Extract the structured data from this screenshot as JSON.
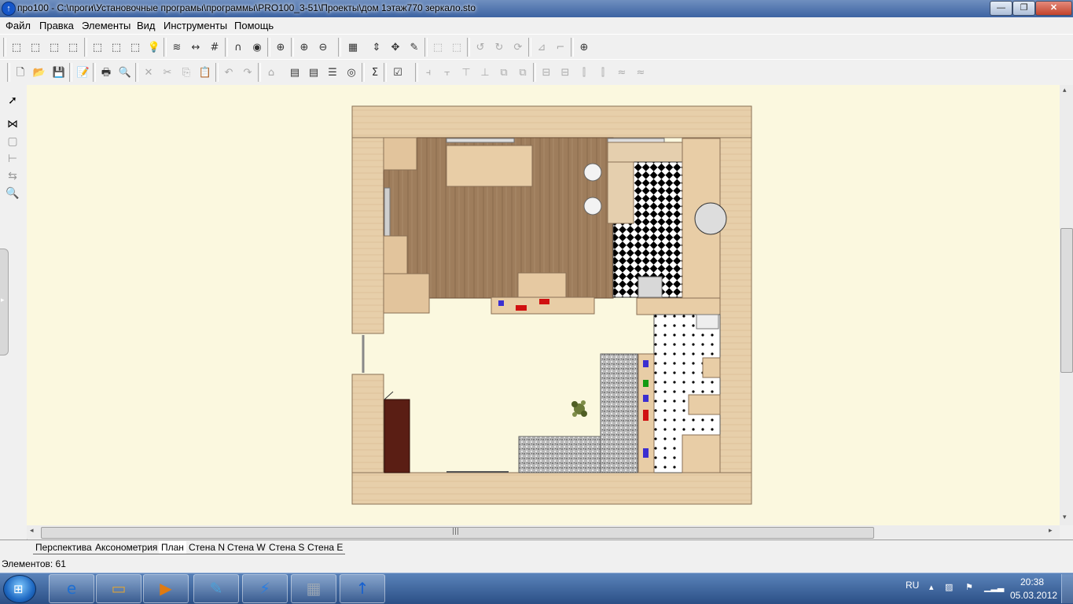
{
  "window": {
    "title": "про100 - С:\\проги\\Установочные програмы\\программы\\PRO100_3-51\\Проекты\\дом 1этаж770 зеркало.sto",
    "app_icon_glyph": "↑",
    "minimize_glyph": "—",
    "maximize_glyph": "❐",
    "close_glyph": "✕"
  },
  "menu": [
    "Файл",
    "Правка",
    "Элементы",
    "Вид",
    "Инструменты",
    "Помощь"
  ],
  "toolbar1": [
    {
      "name": "view-3d-icon-1",
      "glyph": "⬚"
    },
    {
      "name": "view-3d-icon-2",
      "glyph": "⬚"
    },
    {
      "name": "view-3d-icon-3",
      "glyph": "⬚"
    },
    {
      "name": "view-3d-icon-4",
      "glyph": "⬚"
    },
    {
      "name": "view-3d-icon-5",
      "glyph": "⬚"
    },
    {
      "name": "view-3d-icon-6",
      "glyph": "⬚"
    },
    {
      "name": "view-3d-icon-7",
      "glyph": "⬚"
    },
    {
      "name": "light-bulb-icon",
      "glyph": "💡"
    },
    {
      "name": "texture-icon",
      "glyph": "≋"
    },
    {
      "name": "dimension-icon",
      "glyph": "↔"
    },
    {
      "name": "grid-icon",
      "glyph": "#"
    },
    {
      "name": "magnet-icon",
      "glyph": "∩"
    },
    {
      "name": "render-icon",
      "glyph": "◉"
    },
    {
      "name": "target-icon",
      "glyph": "⊕"
    },
    {
      "name": "zoom-in-icon",
      "glyph": "⊕"
    },
    {
      "name": "zoom-out-icon",
      "glyph": "⊖"
    },
    {
      "name": "select-grid-icon",
      "glyph": "▦"
    },
    {
      "name": "lift-icon",
      "glyph": "⇕"
    },
    {
      "name": "move-icon",
      "glyph": "✥"
    },
    {
      "name": "edit-icon",
      "glyph": "✎"
    },
    {
      "name": "group-icon",
      "glyph": "⬚"
    },
    {
      "name": "ungroup-icon",
      "glyph": "⬚"
    },
    {
      "name": "rotate-left-icon",
      "glyph": "↺"
    },
    {
      "name": "rotate-right-icon",
      "glyph": "↻"
    },
    {
      "name": "rotate-icon",
      "glyph": "⟳"
    },
    {
      "name": "mirror-icon",
      "glyph": "⊿"
    },
    {
      "name": "corner-icon",
      "glyph": "⌐"
    },
    {
      "name": "help-target-icon",
      "glyph": "⊕"
    }
  ],
  "toolbar2": [
    {
      "name": "new-file-icon",
      "glyph": "🗋"
    },
    {
      "name": "open-folder-icon",
      "glyph": "📂"
    },
    {
      "name": "save-icon",
      "glyph": "💾"
    },
    {
      "name": "properties-icon",
      "glyph": "📝"
    },
    {
      "name": "print-icon",
      "glyph": "🖶"
    },
    {
      "name": "print-preview-icon",
      "glyph": "🔍"
    },
    {
      "name": "delete-icon",
      "glyph": "✕"
    },
    {
      "name": "cut-icon",
      "glyph": "✂"
    },
    {
      "name": "copy-icon",
      "glyph": "⎘"
    },
    {
      "name": "paste-icon",
      "glyph": "📋"
    },
    {
      "name": "undo-icon",
      "glyph": "↶"
    },
    {
      "name": "redo-icon",
      "glyph": "↷"
    },
    {
      "name": "library-icon",
      "glyph": "⌂"
    },
    {
      "name": "catalog-icon",
      "glyph": "▤"
    },
    {
      "name": "catalog2-icon",
      "glyph": "▤"
    },
    {
      "name": "list-icon",
      "glyph": "☰"
    },
    {
      "name": "coin-icon",
      "glyph": "◎"
    },
    {
      "name": "sum-icon",
      "glyph": "Σ"
    },
    {
      "name": "checklist-icon",
      "glyph": "☑"
    },
    {
      "name": "align-icon-1",
      "glyph": "⫞"
    },
    {
      "name": "align-icon-2",
      "glyph": "⫟"
    },
    {
      "name": "align-icon-3",
      "glyph": "⊤"
    },
    {
      "name": "align-icon-4",
      "glyph": "⊥"
    },
    {
      "name": "align-icon-5",
      "glyph": "⧉"
    },
    {
      "name": "align-icon-6",
      "glyph": "⧉"
    },
    {
      "name": "align-icon-7",
      "glyph": "⊟"
    },
    {
      "name": "align-icon-8",
      "glyph": "⊟"
    },
    {
      "name": "align-icon-9",
      "glyph": "⫿"
    },
    {
      "name": "align-icon-10",
      "glyph": "⫿"
    },
    {
      "name": "align-icon-11",
      "glyph": "≈"
    },
    {
      "name": "align-icon-12",
      "glyph": "≈"
    }
  ],
  "left_tools": [
    {
      "name": "pointer-icon",
      "glyph": "➚"
    },
    {
      "name": "wall-icon",
      "glyph": "⋈"
    },
    {
      "name": "box-icon",
      "glyph": "▢"
    },
    {
      "name": "distribute-icon",
      "glyph": "⊢"
    },
    {
      "name": "arrange-icon",
      "glyph": "⇆"
    },
    {
      "name": "zoom-tool-icon",
      "glyph": "🔍"
    }
  ],
  "scroll": {
    "left": "◂",
    "right": "▸",
    "up": "▴",
    "down": "▾",
    "grip": "|||"
  },
  "view_tabs": [
    "Перспектива",
    "Аксонометрия",
    "План",
    "Стена N",
    "Стена W",
    "Стена S",
    "Стена E"
  ],
  "active_tab": "План",
  "status": "Элементов: 61",
  "colors": {
    "canvas": "#fbf8df",
    "wall": "#e8c9a0",
    "floor_wood": "#9b7a5a",
    "fabric": "#e6cda8",
    "marker_blue": "#3b2fd0",
    "marker_red": "#d01010",
    "marker_green": "#129a12"
  },
  "taskbar": {
    "language": "RU",
    "time": "20:38",
    "date": "05.03.2012",
    "apps": [
      {
        "name": "internet-explorer-icon",
        "glyph": "e"
      },
      {
        "name": "explorer-folder-icon",
        "glyph": "▭"
      },
      {
        "name": "media-player-icon",
        "glyph": "▶"
      },
      {
        "name": "paint-icon",
        "glyph": "✎"
      },
      {
        "name": "flash-icon",
        "glyph": "⚡"
      },
      {
        "name": "calculator-icon",
        "glyph": "▦"
      },
      {
        "name": "pro100-icon",
        "glyph": "↑"
      }
    ],
    "tray_icons": [
      {
        "name": "show-hidden-icon",
        "glyph": "▴"
      },
      {
        "name": "network-icon",
        "glyph": "▨"
      },
      {
        "name": "action-center-icon",
        "glyph": "⚑"
      },
      {
        "name": "signal-icon",
        "glyph": "▁▂▃"
      }
    ]
  }
}
